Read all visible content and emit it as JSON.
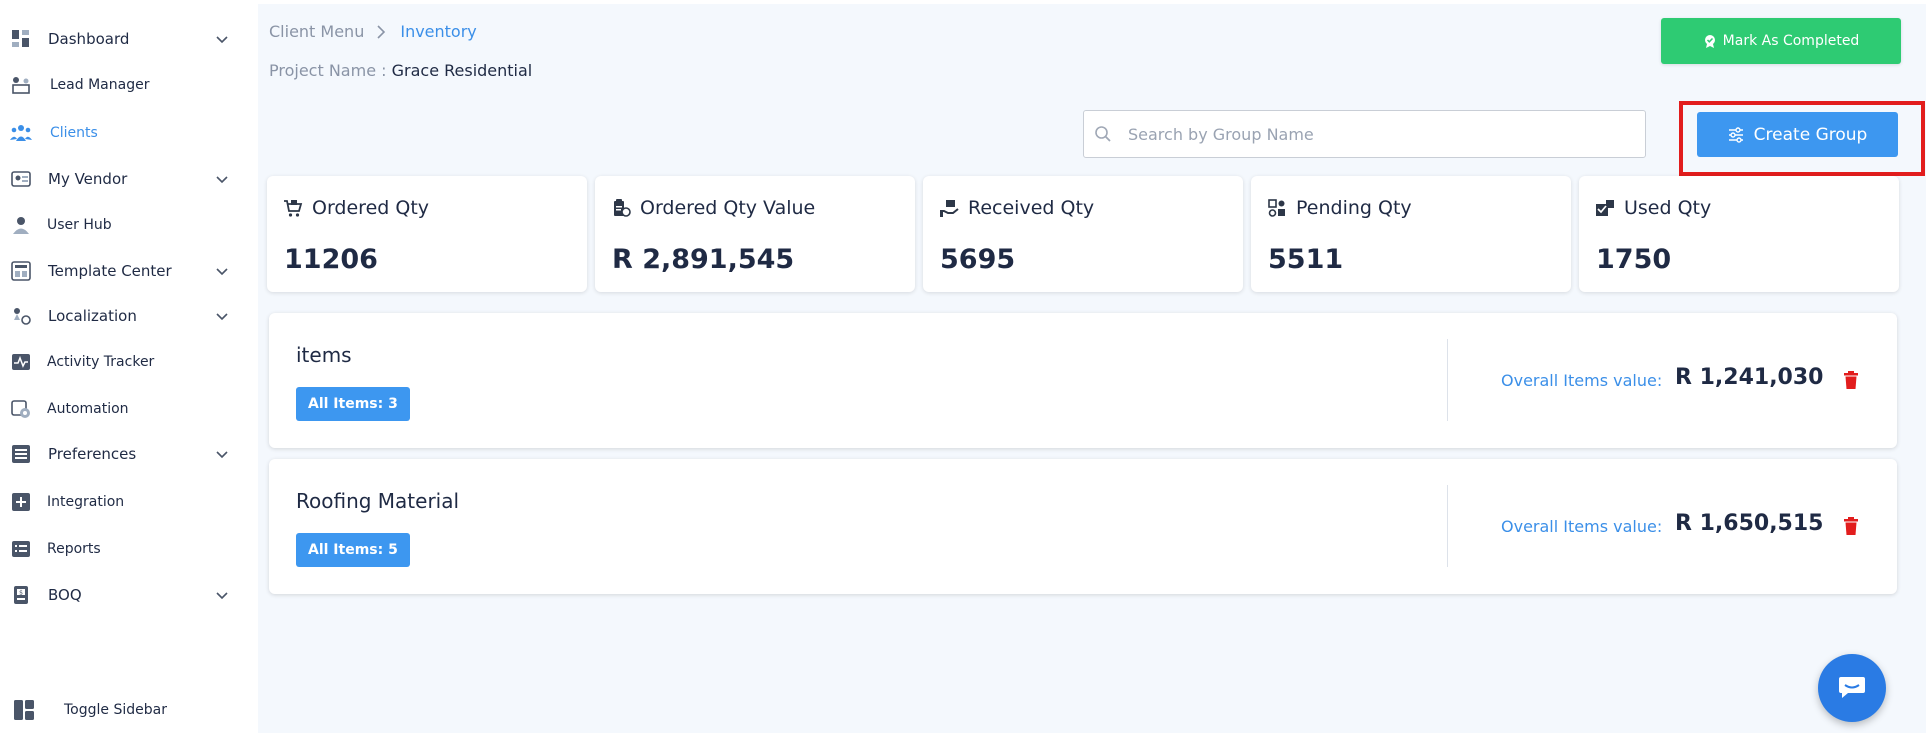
{
  "sidebar": {
    "items": [
      {
        "label": "Dashboard",
        "icon": "dashboard-icon",
        "has_chevron": true
      },
      {
        "label": "Lead Manager",
        "icon": "lead-manager-icon",
        "has_chevron": false
      },
      {
        "label": "Clients",
        "icon": "clients-icon",
        "has_chevron": false,
        "active": true
      },
      {
        "label": "My Vendor",
        "icon": "vendor-icon",
        "has_chevron": true
      },
      {
        "label": "User Hub",
        "icon": "user-icon",
        "has_chevron": false
      },
      {
        "label": "Template Center",
        "icon": "template-icon",
        "has_chevron": true
      },
      {
        "label": "Localization",
        "icon": "localization-icon",
        "has_chevron": true
      },
      {
        "label": "Activity Tracker",
        "icon": "activity-icon",
        "has_chevron": false
      },
      {
        "label": "Automation",
        "icon": "automation-icon",
        "has_chevron": false
      },
      {
        "label": "Preferences",
        "icon": "preferences-icon",
        "has_chevron": true
      },
      {
        "label": "Integration",
        "icon": "integration-icon",
        "has_chevron": false
      },
      {
        "label": "Reports",
        "icon": "reports-icon",
        "has_chevron": false
      },
      {
        "label": "BOQ",
        "icon": "boq-icon",
        "has_chevron": true
      }
    ],
    "toggle_label": "Toggle Sidebar"
  },
  "breadcrumb": {
    "items": [
      "Client Menu",
      "Inventory"
    ]
  },
  "project": {
    "label": "Project Name :",
    "name": "Grace Residential"
  },
  "actions": {
    "mark_completed": "Mark As Completed",
    "create_group": "Create Group"
  },
  "search": {
    "placeholder": "Search by Group Name",
    "value": ""
  },
  "stats": [
    {
      "label": "Ordered Qty",
      "value": "11206",
      "icon": "cart-icon"
    },
    {
      "label": "Ordered Qty Value",
      "value": "R 2,891,545",
      "icon": "value-icon"
    },
    {
      "label": "Received Qty",
      "value": "5695",
      "icon": "received-icon"
    },
    {
      "label": "Pending Qty",
      "value": "5511",
      "icon": "pending-icon"
    },
    {
      "label": "Used Qty",
      "value": "1750",
      "icon": "used-icon"
    }
  ],
  "groups": [
    {
      "name": "items",
      "badge": "All Items: 3",
      "value_label": "Overall Items value:",
      "value": "R 1,241,030"
    },
    {
      "name": "Roofing Material",
      "badge": "All Items: 5",
      "value_label": "Overall Items value:",
      "value": "R 1,650,515"
    }
  ],
  "colors": {
    "accent": "#3d97f0",
    "success": "#2ecb73",
    "danger": "#e21d1d",
    "highlight": "#e21d1d"
  }
}
